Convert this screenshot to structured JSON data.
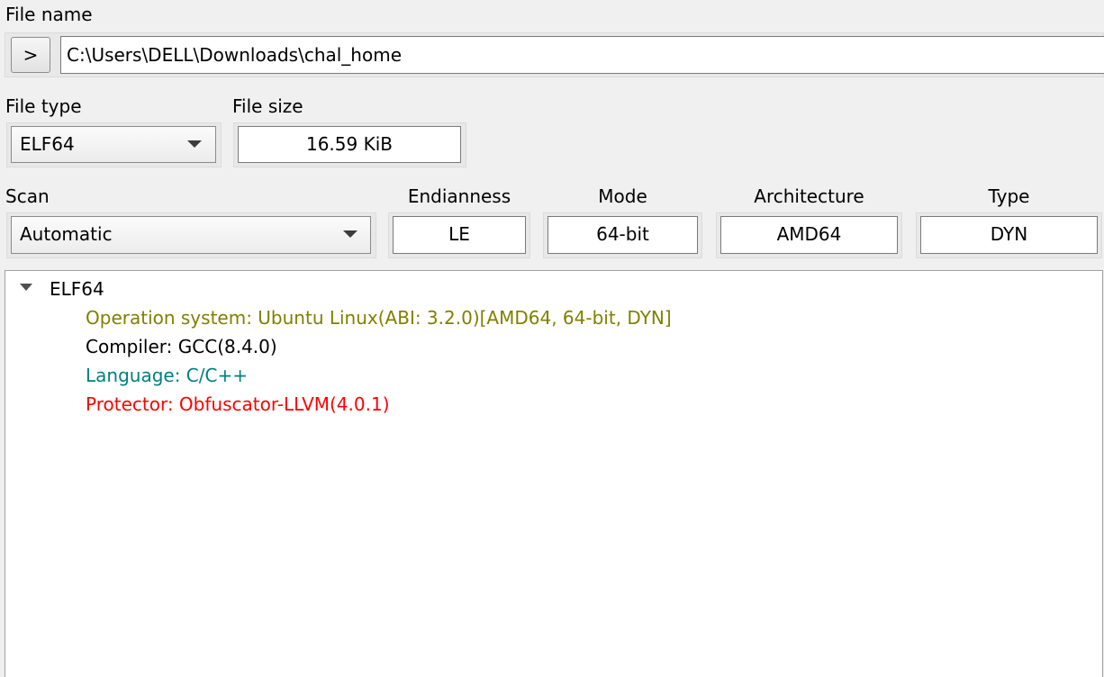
{
  "file_name": {
    "label": "File name",
    "browse_button": ">",
    "path": "C:\\Users\\DELL\\Downloads\\chal_home"
  },
  "file_type": {
    "label": "File type",
    "value": "ELF64"
  },
  "file_size": {
    "label": "File size",
    "value": "16.59 KiB"
  },
  "scan": {
    "label": "Scan",
    "value": "Automatic"
  },
  "endianness": {
    "label": "Endianness",
    "value": "LE"
  },
  "mode": {
    "label": "Mode",
    "value": "64-bit"
  },
  "architecture": {
    "label": "Architecture",
    "value": "AMD64"
  },
  "type": {
    "label": "Type",
    "value": "DYN"
  },
  "results": {
    "root": "ELF64",
    "items": [
      {
        "text": "Operation system: Ubuntu Linux(ABI: 3.2.0)[AMD64, 64-bit, DYN]",
        "color": "#808000"
      },
      {
        "text": "Compiler: GCC(8.4.0)",
        "color": "#000000"
      },
      {
        "text": "Language: C/C++",
        "color": "#008080"
      },
      {
        "text": "Protector: Obfuscator-LLVM(4.0.1)",
        "color": "#ff0000"
      }
    ]
  }
}
